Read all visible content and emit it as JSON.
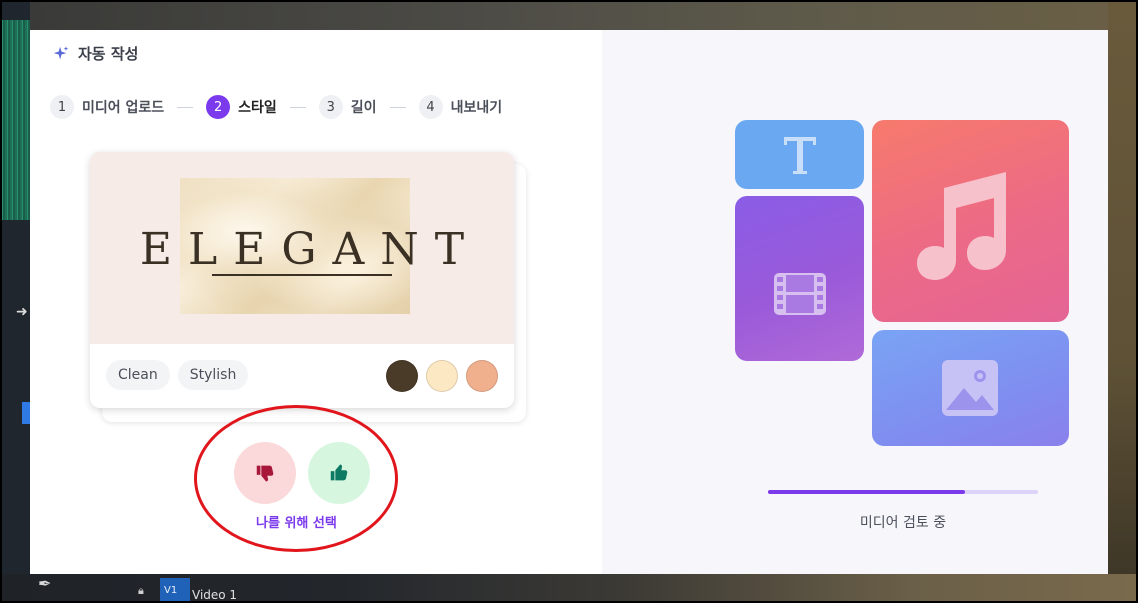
{
  "background": {
    "track_label": "V1",
    "video_label": "Video 1"
  },
  "dialog": {
    "title": "자동 작성",
    "steps": [
      {
        "num": "1",
        "label": "미디어 업로드"
      },
      {
        "num": "2",
        "label": "스타일",
        "active": true
      },
      {
        "num": "3",
        "label": "길이"
      },
      {
        "num": "4",
        "label": "내보내기"
      }
    ],
    "style_card": {
      "preview_text": "ELEGANT",
      "tags": [
        "Clean",
        "Stylish"
      ],
      "swatches": [
        "#4a3a28",
        "#fde8c4",
        "#f0b08e"
      ]
    },
    "feedback": {
      "label": "나를 위해 선택"
    },
    "review": {
      "progress": 0.73,
      "status": "미디어 검토 중"
    }
  },
  "colors": {
    "accent": "#7c3aed",
    "annotation": "#e0161c"
  }
}
